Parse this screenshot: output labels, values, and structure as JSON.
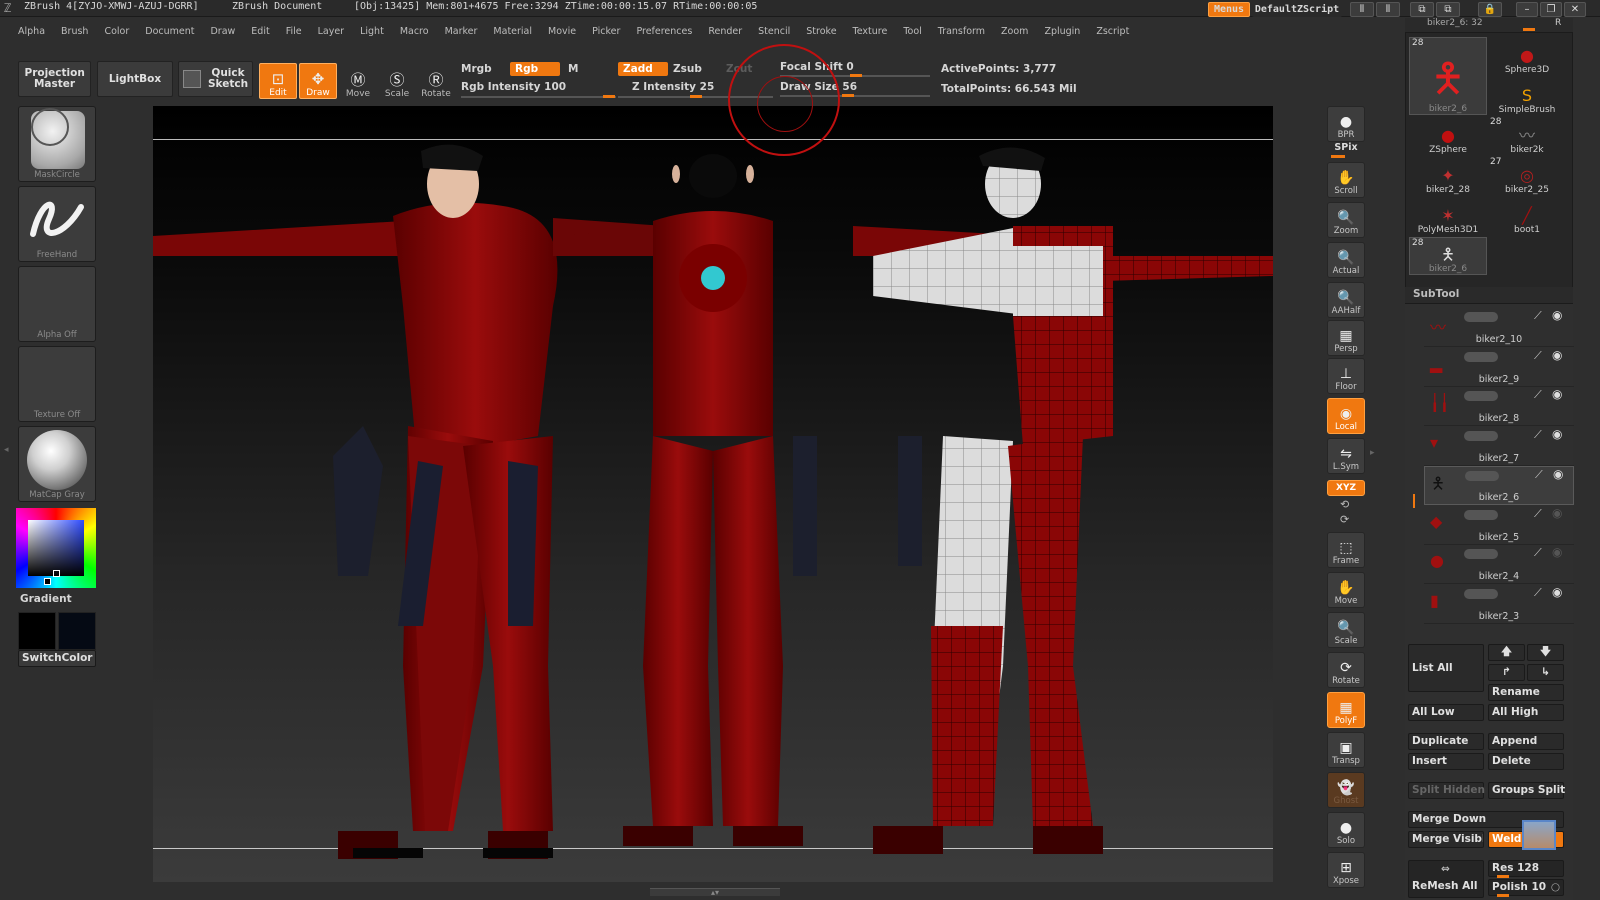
{
  "title": {
    "app": "ZBrush 4[ZYJO-XMWJ-AZUJ-DGRR]",
    "doc": "ZBrush Document",
    "stats": "[Obj:13425] Mem:801+4675 Free:3294 ZTime:00:00:15.07 RTime:00:00:05",
    "menus_btn": "Menus",
    "script": "DefaultZScript",
    "tool_title": "biker2_6: 32"
  },
  "menus": [
    "Alpha",
    "Brush",
    "Color",
    "Document",
    "Draw",
    "Edit",
    "File",
    "Layer",
    "Light",
    "Macro",
    "Marker",
    "Material",
    "Movie",
    "Picker",
    "Preferences",
    "Render",
    "Stencil",
    "Stroke",
    "Texture",
    "Tool",
    "Transform",
    "Zoom",
    "Zplugin",
    "Zscript"
  ],
  "toolbar": {
    "projection_master": "Projection Master",
    "lightbox": "LightBox",
    "quick_sketch": "Quick Sketch",
    "edit": "Edit",
    "draw": "Draw",
    "move": "Move",
    "scale": "Scale",
    "rotate": "Rotate",
    "mrgb": "Mrgb",
    "rgb": "Rgb",
    "m": "M",
    "rgb_intensity": "Rgb Intensity 100",
    "zadd": "Zadd",
    "zsub": "Zsub",
    "zcut": "Zcut",
    "z_intensity": "Z Intensity 25",
    "focal_shift": "Focal Shift 0",
    "draw_size": "Draw Size 56",
    "active_points": "ActivePoints: 3,777",
    "total_points": "TotalPoints: 66.543 Mil"
  },
  "left": {
    "brush_alpha": "MaskCircle",
    "stroke": "FreeHand",
    "alpha": "Alpha Off",
    "texture": "Texture Off",
    "material": "MatCap Gray",
    "gradient": "Gradient",
    "switch_color": "SwitchColor"
  },
  "shelf": [
    {
      "label": "BPR",
      "on": false
    },
    {
      "label": "SPix",
      "on": false
    },
    {
      "label": "Scroll",
      "on": false
    },
    {
      "label": "Zoom",
      "on": false
    },
    {
      "label": "Actual",
      "on": false
    },
    {
      "label": "AAHalf",
      "on": false
    },
    {
      "label": "Persp",
      "on": false
    },
    {
      "label": "Floor",
      "on": false
    },
    {
      "label": "Local",
      "on": true
    },
    {
      "label": "L.Sym",
      "on": false
    },
    {
      "label": "XYZ",
      "on": true
    },
    {
      "label": "Frame",
      "on": false
    },
    {
      "label": "Move",
      "on": false
    },
    {
      "label": "Scale",
      "on": false
    },
    {
      "label": "Rotate",
      "on": false
    },
    {
      "label": "PolyF",
      "on": true
    },
    {
      "label": "Transp",
      "on": false
    },
    {
      "label": "Ghost",
      "on": false
    },
    {
      "label": "Solo",
      "on": false
    },
    {
      "label": "Xpose",
      "on": false
    }
  ],
  "tools": [
    {
      "name": "biker2_6",
      "count": "28"
    },
    {
      "name": "Sphere3D",
      "count": ""
    },
    {
      "name": "SimpleBrush",
      "count": ""
    },
    {
      "name": "ZSphere",
      "count": ""
    },
    {
      "name": "biker2k",
      "count": "28"
    },
    {
      "name": "biker2_28",
      "count": ""
    },
    {
      "name": "biker2_25",
      "count": "27"
    },
    {
      "name": "PolyMesh3D1",
      "count": ""
    },
    {
      "name": "boot1",
      "count": ""
    },
    {
      "name": "biker2_6",
      "count": "28"
    }
  ],
  "subtool": {
    "header": "SubTool",
    "items": [
      "biker2_10",
      "biker2_9",
      "biker2_8",
      "biker2_7",
      "biker2_6",
      "biker2_5",
      "biker2_4",
      "biker2_3"
    ],
    "selected_index": 4,
    "list_all": "List All",
    "rename": "Rename",
    "all_low": "All Low",
    "all_high": "All High",
    "duplicate": "Duplicate",
    "append": "Append",
    "insert": "Insert",
    "delete": "Delete",
    "split_hidden": "Split Hidden",
    "groups_split": "Groups Split",
    "merge_down": "Merge Down",
    "merge_visible": "Merge Visible",
    "weld": "Weld",
    "remesh_all": "ReMesh All",
    "res": "Res 128",
    "polish": "Polish 10"
  }
}
